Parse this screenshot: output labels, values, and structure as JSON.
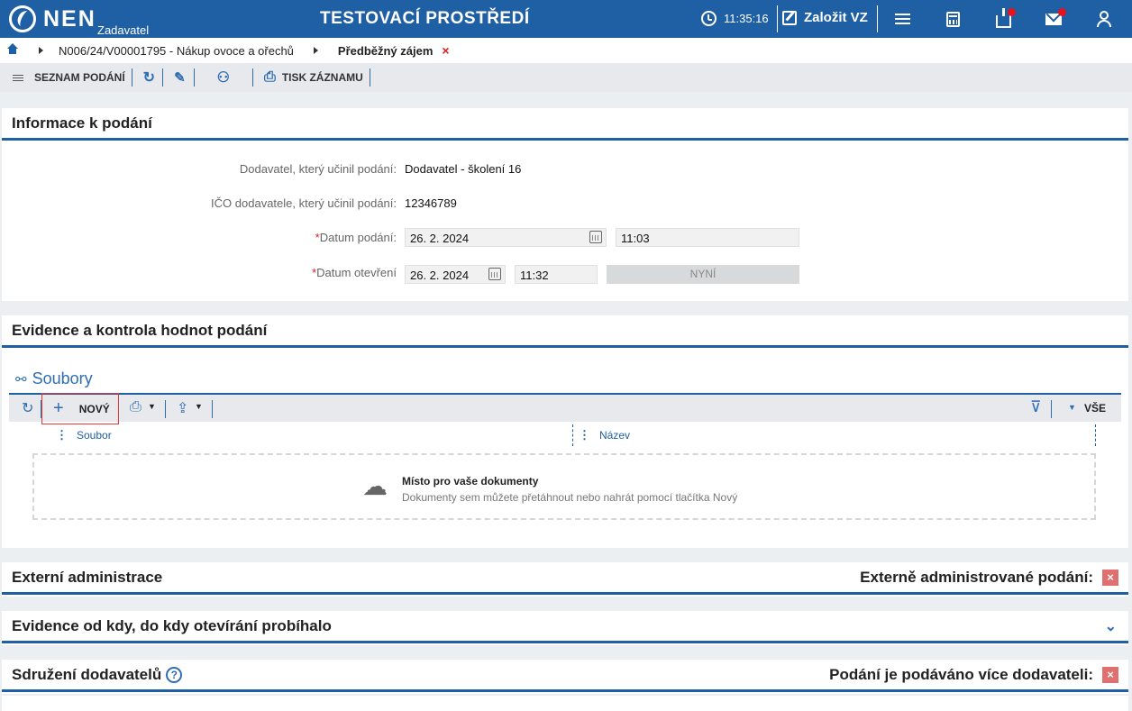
{
  "header": {
    "logo": "NEN",
    "logo_sub": "Zadavatel",
    "env_title": "TESTOVACÍ PROSTŘEDÍ",
    "time": "11:35:16",
    "create_label": "Založit VZ"
  },
  "breadcrumb": {
    "item1": "N006/24/V00001795 - Nákup ovoce a ořechů",
    "item2": "Předběžný zájem",
    "close": "×"
  },
  "toolbar": {
    "list_label": "SEZNAM PODÁNÍ",
    "print_label": "TISK ZÁZNAMU"
  },
  "info": {
    "title": "Informace k podání",
    "supplier_label": "Dodavatel, který učinil podání:",
    "supplier_value": "Dodavatel - školení 16",
    "ico_label": "IČO dodavatele, který učinil podání:",
    "ico_value": "12346789",
    "date_label": "Datum podání:",
    "date_value": "26. 2. 2024",
    "time_value": "11:03",
    "open_label": "Datum otevření",
    "open_date": "26. 2. 2024",
    "open_time": "11:32",
    "now_button": "NYNÍ"
  },
  "evidence": {
    "title": "Evidence a kontrola hodnot podání",
    "files_title": "Soubory",
    "new_button": "NOVÝ",
    "all_label": "VŠE",
    "col_file": "Soubor",
    "col_name": "Název",
    "drop_title": "Místo pro vaše dokumenty",
    "drop_text": "Dokumenty sem můžete přetáhnout nebo nahrát pomocí tlačítka Nový"
  },
  "external": {
    "title": "Externí administrace",
    "right_label": "Externě administrované podání:"
  },
  "opening": {
    "title": "Evidence od kdy, do kdy otevírání probíhalo"
  },
  "association": {
    "title": "Sdružení dodavatelů",
    "help": "?",
    "right_label": "Podání je podáváno více dodavateli:"
  },
  "colors": {
    "brand": "#1f5fa4",
    "accent": "#2f6db3",
    "danger": "#e01b1b"
  }
}
